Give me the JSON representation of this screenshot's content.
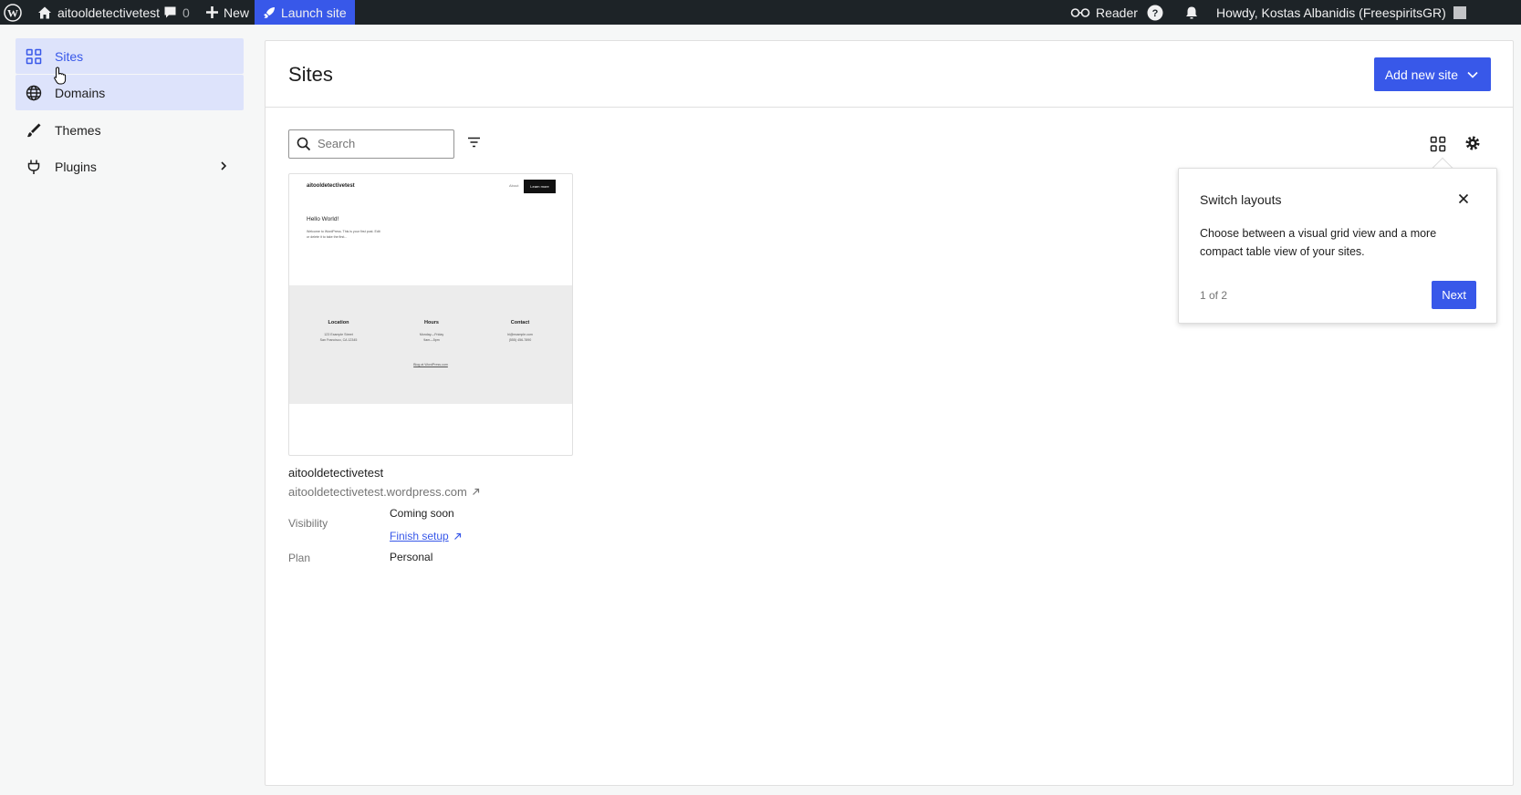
{
  "admin_bar": {
    "site_name": "aitooldetectivetest",
    "comments_count": "0",
    "new_label": "New",
    "launch_label": "Launch site",
    "reader_label": "Reader",
    "greeting": "Howdy, Kostas Albanidis (FreespiritsGR)"
  },
  "sidebar": {
    "items": [
      {
        "label": "Sites",
        "icon": "grid-icon",
        "state": "active"
      },
      {
        "label": "Domains",
        "icon": "globe-icon",
        "state": "hover"
      },
      {
        "label": "Themes",
        "icon": "brush-icon",
        "state": "normal"
      },
      {
        "label": "Plugins",
        "icon": "plug-icon",
        "state": "normal",
        "has_submenu": true
      }
    ]
  },
  "main": {
    "title": "Sites",
    "add_button_label": "Add new site",
    "search_placeholder": "Search",
    "site": {
      "name": "aitooldetectivetest",
      "url": "aitooldetectivetest.wordpress.com",
      "visibility_label": "Visibility",
      "visibility_value": "Coming soon",
      "finish_setup_label": "Finish setup",
      "plan_label": "Plan",
      "plan_value": "Personal",
      "preview": {
        "site_title": "aitooldetectivetest",
        "nav_about": "About",
        "nav_button": "Learn more",
        "heading": "Hello World!",
        "body": "Welcome to WordPress. This is your first post. Edit or delete it to take the first...",
        "columns": [
          {
            "heading": "Location",
            "line1": "123 Example Street",
            "line2": "San Francisco, CA 12345"
          },
          {
            "heading": "Hours",
            "line1": "Monday—Friday",
            "line2": "9am—5pm"
          },
          {
            "heading": "Contact",
            "line1": "hi@example.com",
            "line2": "(555) 456-7890"
          }
        ],
        "blog_link": "Blog at WordPress.com"
      }
    }
  },
  "tour": {
    "title": "Switch layouts",
    "body": "Choose between a visual grid view and a more compact table view of your sites.",
    "step": "1 of 2",
    "next_label": "Next"
  },
  "colors": {
    "accent": "#3858e9",
    "admin_bar": "#1d2327",
    "active_bg": "#dde3fb"
  }
}
